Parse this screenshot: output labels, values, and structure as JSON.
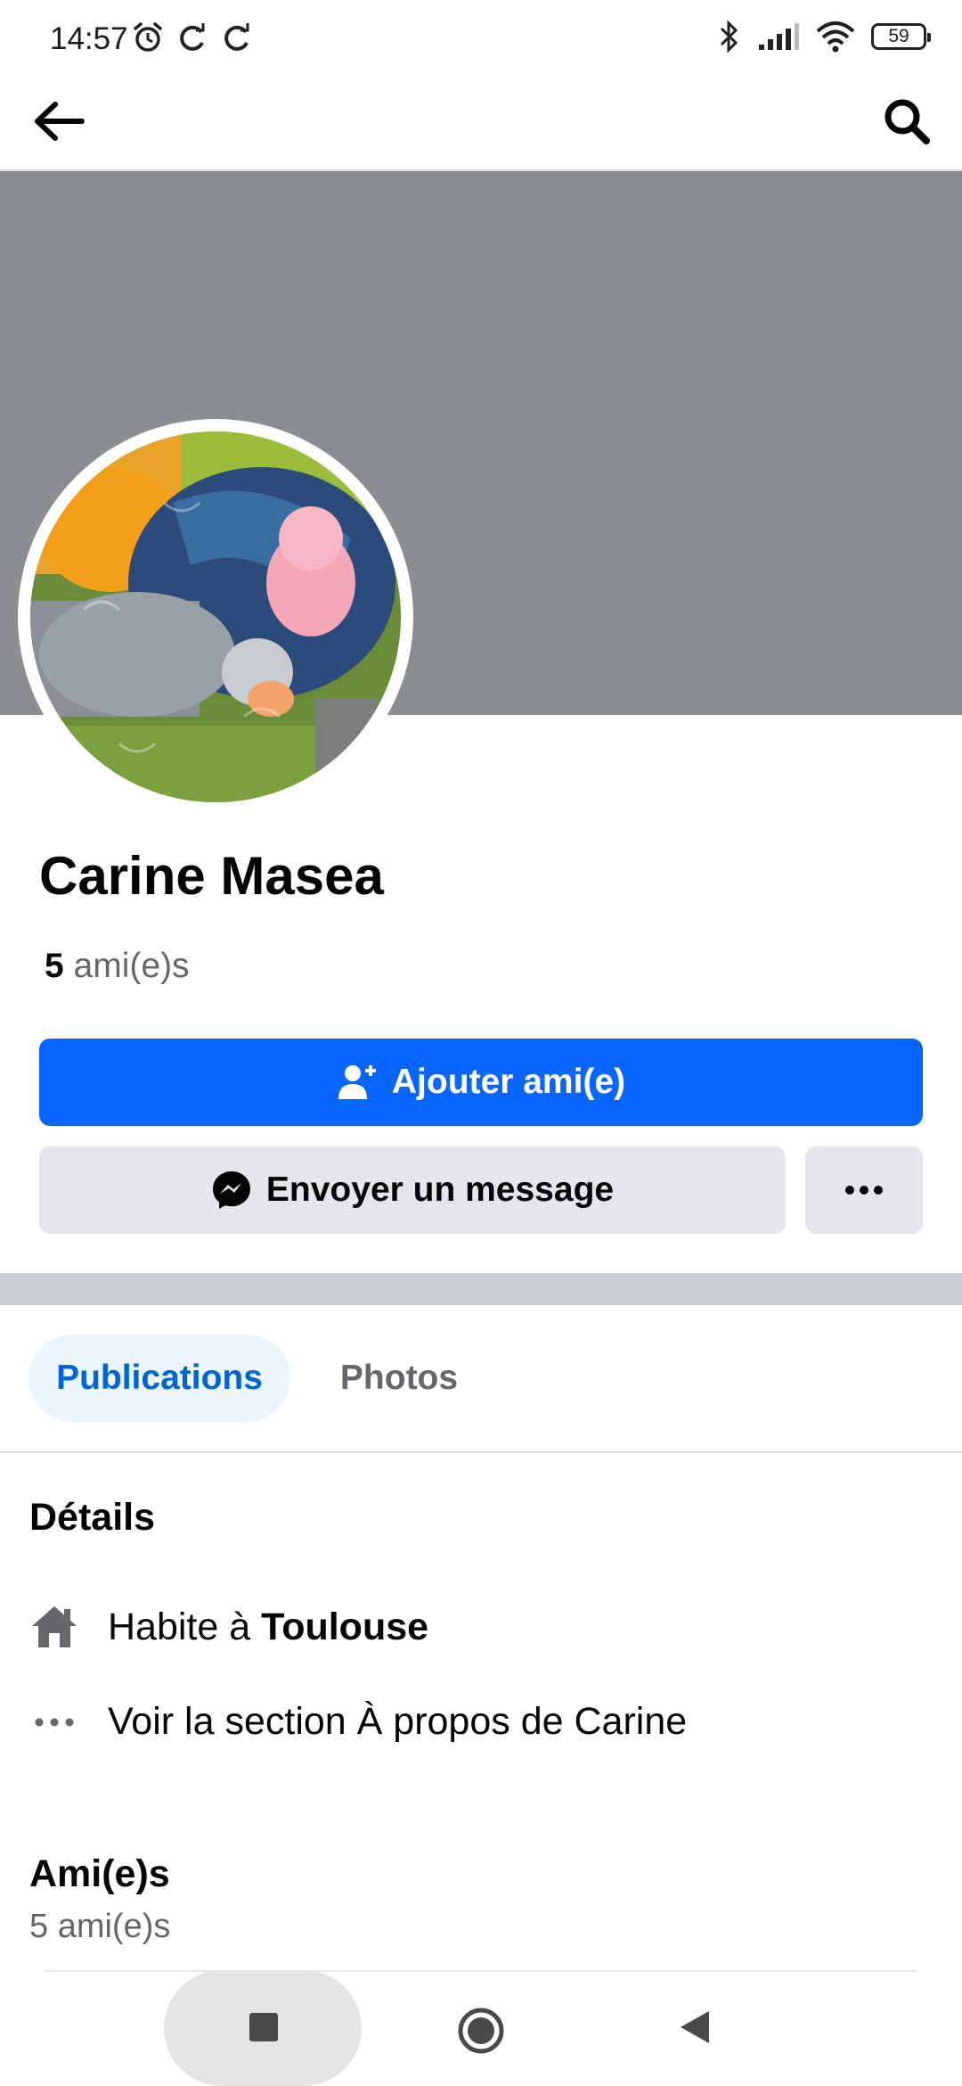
{
  "status_bar": {
    "time": "14:57",
    "battery": "59"
  },
  "profile": {
    "name": "Carine Masea",
    "friends_number": "5",
    "friends_suffix": "ami(e)s"
  },
  "actions": {
    "add_friend_label": "Ajouter ami(e)",
    "message_label": "Envoyer un message"
  },
  "tabs": [
    {
      "label": "Publications",
      "selected": true
    },
    {
      "label": "Photos",
      "selected": false
    }
  ],
  "details": {
    "title": "Détails",
    "lives_in_prefix": "Habite à",
    "lives_in_city": "Toulouse",
    "about_link": "Voir la section À propos de Carine"
  },
  "friends_section": {
    "title": "Ami(e)s",
    "count_text": "5 ami(e)s"
  },
  "colors": {
    "primary": "#0866ff",
    "cover": "#8a8d91",
    "tab_selected_bg": "#ebf5ff",
    "tab_selected_text": "#0064d1",
    "secondary_button": "#e4e6eb"
  },
  "icons": {
    "back": "arrow-left-icon",
    "search": "search-icon",
    "add_friend": "person-plus-icon",
    "messenger": "messenger-icon",
    "more": "more-dots-icon",
    "home": "house-icon",
    "about": "more-dots-icon"
  }
}
